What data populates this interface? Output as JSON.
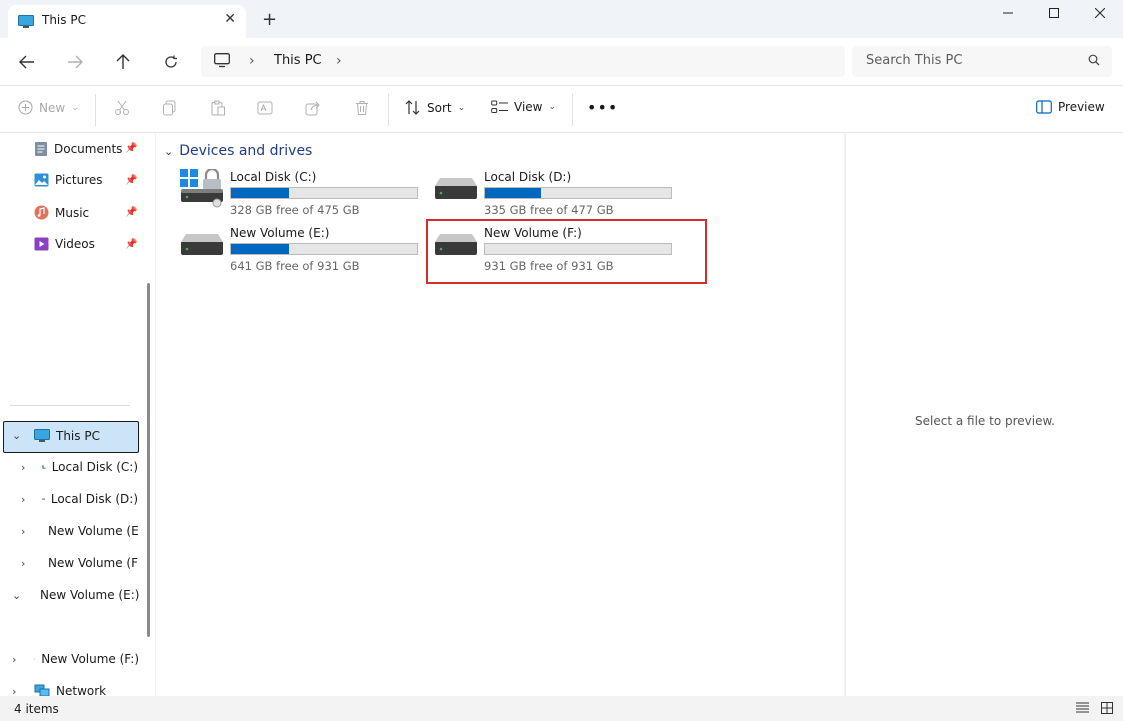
{
  "window": {
    "tab_title": "This PC",
    "tab_close_icon": "close-icon",
    "new_tab_icon": "plus-icon"
  },
  "address": {
    "path": "This PC",
    "search_placeholder": "Search This PC"
  },
  "toolbar": {
    "new_label": "New",
    "sort_label": "Sort",
    "view_label": "View",
    "preview_label": "Preview"
  },
  "sidebar": {
    "quick_access": [
      {
        "label": "Documents",
        "icon": "documents-icon"
      },
      {
        "label": "Pictures",
        "icon": "pictures-icon"
      },
      {
        "label": "Music",
        "icon": "music-icon"
      },
      {
        "label": "Videos",
        "icon": "videos-icon"
      }
    ],
    "tree": [
      {
        "label": "This PC"
      },
      {
        "label": "Local Disk (C:)"
      },
      {
        "label": "Local Disk (D:)"
      },
      {
        "label": "New  Volume (E:)"
      },
      {
        "label": "New Volume (F:)"
      },
      {
        "label": "New  Volume (E:)"
      },
      {
        "label": "New Volume (F:)"
      },
      {
        "label": "Network"
      }
    ]
  },
  "main": {
    "group_title": "Devices and drives",
    "drives": [
      {
        "name": "Local Disk (C:)",
        "free": "328 GB free of 475 GB",
        "used_fraction": 0.31
      },
      {
        "name": "Local Disk (D:)",
        "free": "335 GB free of 477 GB",
        "used_fraction": 0.3
      },
      {
        "name": "New  Volume (E:)",
        "free": "641 GB free of 931 GB",
        "used_fraction": 0.31
      },
      {
        "name": "New Volume (F:)",
        "free": "931 GB free of 931 GB",
        "used_fraction": 0.0
      }
    ]
  },
  "preview": {
    "placeholder": "Select a file to preview."
  },
  "status": {
    "item_count": "4 items"
  },
  "colors": {
    "accent": "#0067c0",
    "highlight": "#d32f2f",
    "selection": "#cce4f7"
  }
}
